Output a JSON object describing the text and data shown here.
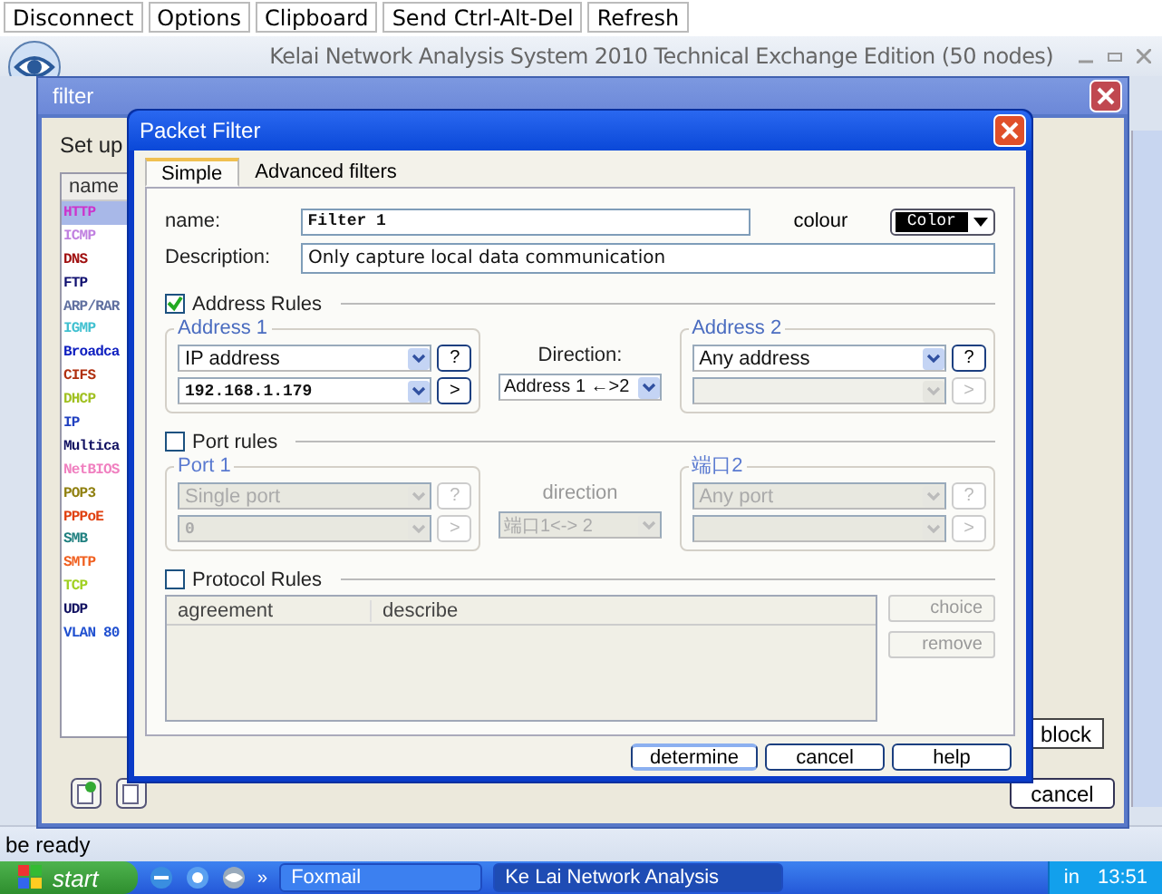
{
  "toolbar": {
    "buttons": [
      "Disconnect",
      "Options",
      "Clipboard",
      "Send Ctrl-Alt-Del",
      "Refresh"
    ]
  },
  "window": {
    "title": "Kelai Network Analysis System 2010 Technical Exchange Edition (50 nodes)"
  },
  "filter_window": {
    "title": "filter",
    "section_label": "Set up",
    "list_header": "name",
    "protocols": [
      {
        "name": "HTTP",
        "color": "#cc33cc",
        "selected": true
      },
      {
        "name": "ICMP",
        "color": "#c080e0",
        "selected": false
      },
      {
        "name": "DNS",
        "color": "#a01010",
        "selected": false
      },
      {
        "name": "FTP",
        "color": "#101070",
        "selected": false
      },
      {
        "name": "ARP/RAR",
        "color": "#6070a0",
        "selected": false
      },
      {
        "name": "IGMP",
        "color": "#40c0d0",
        "selected": false
      },
      {
        "name": "Broadca",
        "color": "#1020c0",
        "selected": false
      },
      {
        "name": "CIFS",
        "color": "#b03010",
        "selected": false
      },
      {
        "name": "DHCP",
        "color": "#a0c020",
        "selected": false
      },
      {
        "name": "IP",
        "color": "#2040c0",
        "selected": false
      },
      {
        "name": "Multica",
        "color": "#101060",
        "selected": false
      },
      {
        "name": "NetBIOS",
        "color": "#f080c0",
        "selected": false
      },
      {
        "name": "POP3",
        "color": "#908010",
        "selected": false
      },
      {
        "name": "PPPoE",
        "color": "#e04010",
        "selected": false
      },
      {
        "name": "SMB",
        "color": "#208080",
        "selected": false
      },
      {
        "name": "SMTP",
        "color": "#f06020",
        "selected": false
      },
      {
        "name": "TCP",
        "color": "#a0d020",
        "selected": false
      },
      {
        "name": "UDP",
        "color": "#101060",
        "selected": false
      },
      {
        "name": "VLAN 80",
        "color": "#2050d0",
        "selected": false
      }
    ],
    "block_button": "block",
    "cancel_button": "cancel"
  },
  "packet_filter": {
    "title": "Packet Filter",
    "tabs": [
      {
        "label": "Simple",
        "selected": true
      },
      {
        "label": "Advanced filters",
        "selected": false
      }
    ],
    "name_label": "name:",
    "name_value": "Filter 1",
    "colour_label": "colour",
    "colour_button": "Color",
    "description_label": "Description:",
    "description_value": "Only capture local data communication",
    "address_rules": {
      "label": "Address Rules",
      "checked": true,
      "group1": {
        "title": "Address 1",
        "type": "IP address",
        "value": "192.168.1.179",
        "help_button": "?",
        "next_button": ">"
      },
      "direction_label": "Direction:",
      "direction": "Address 1 ←>2",
      "group2": {
        "title": "Address 2",
        "type": "Any address",
        "help_button": "?",
        "next_button": ">"
      }
    },
    "port_rules": {
      "label": "Port rules",
      "checked": false,
      "group1": {
        "title": "Port 1",
        "type": "Single port",
        "value": "0",
        "help_button": "?",
        "next_button": ">"
      },
      "direction_label": "direction",
      "direction": "端口1<-> 2",
      "group2": {
        "title": "端口2",
        "type": "Any port",
        "help_button": "?",
        "next_button": ">"
      }
    },
    "protocol_rules": {
      "label": "Protocol Rules",
      "checked": false,
      "columns": [
        "agreement",
        "describe"
      ],
      "buttons": [
        "choice",
        "remove"
      ]
    },
    "buttons": [
      "determine",
      "cancel",
      "help"
    ]
  },
  "status_bar": "be ready",
  "taskbar": {
    "start": "start",
    "more": "»",
    "items": [
      {
        "label": "Foxmail",
        "selected": false
      },
      {
        "label": "Ke Lai Network Analysis",
        "selected": true
      }
    ],
    "tray_text": "in",
    "clock": "13:51"
  }
}
